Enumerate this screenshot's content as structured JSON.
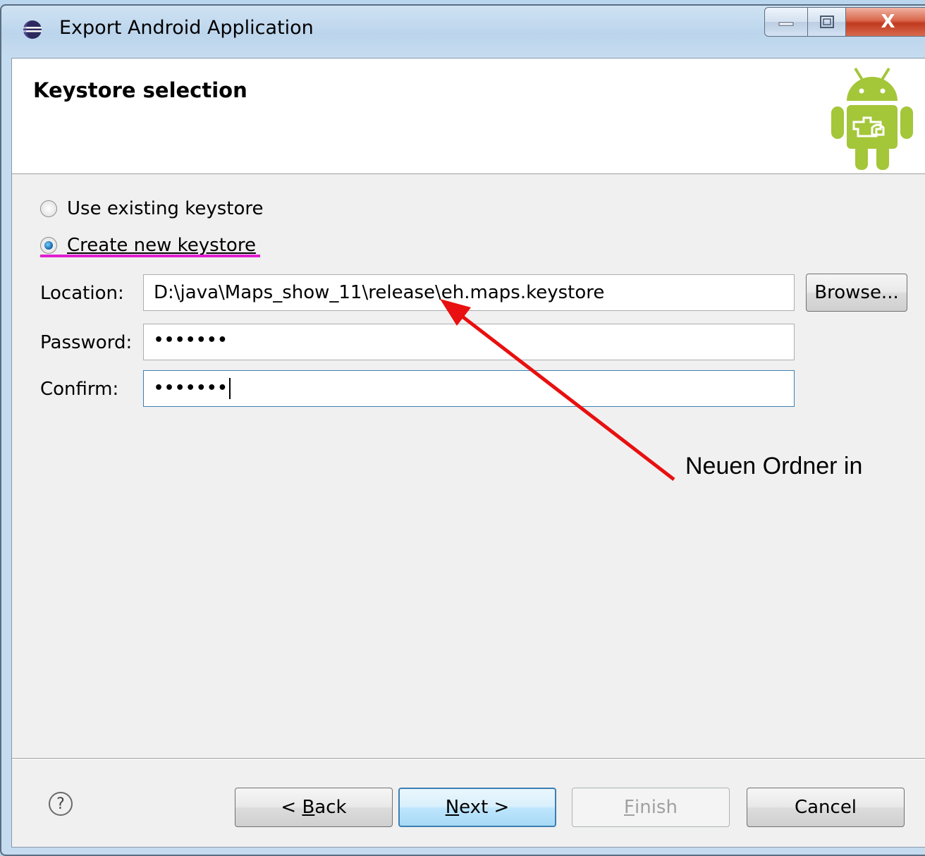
{
  "window": {
    "title": "Export Android Application",
    "close_label": "X"
  },
  "header": {
    "title": "Keystore selection"
  },
  "options": {
    "use_existing": "Use existing keystore",
    "create_new": "Create new keystore",
    "selected": "create_new"
  },
  "form": {
    "location_label": "Location:",
    "location_value": "D:\\java\\Maps_show_11\\release\\eh.maps.keystore",
    "browse_label": "Browse...",
    "password_label": "Password:",
    "password_value": "•••••••",
    "confirm_label": "Confirm:",
    "confirm_value": "•••••••"
  },
  "buttons": {
    "help": "?",
    "back_prefix": "< ",
    "back_mnemonic": "B",
    "back_rest": "ack",
    "next_mnemonic": "N",
    "next_rest": "ext >",
    "finish_mnemonic": "F",
    "finish_rest": "inish",
    "cancel": "Cancel"
  },
  "annotation": {
    "text": "Neuen Ordner in",
    "color": "#e81010",
    "underline_color": "#e020d0"
  },
  "colors": {
    "android_green": "#a4c639",
    "accent_blue": "#3c7fb1"
  }
}
